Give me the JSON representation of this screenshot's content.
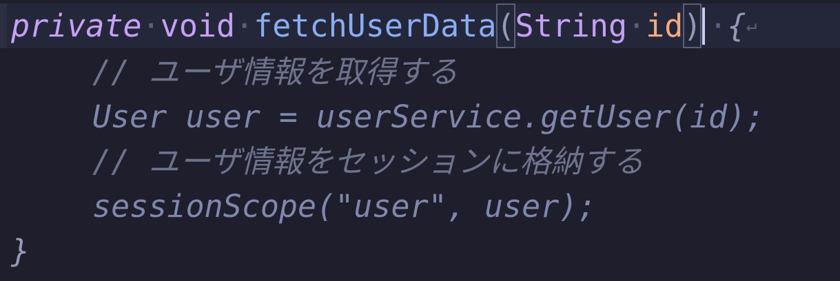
{
  "editor": {
    "line1": {
      "kw_private": "private",
      "kw_void": "void",
      "fn_name": "fetchUserData",
      "open_paren": "(",
      "param_type": "String",
      "param_name": "id",
      "close_paren": ")",
      "open_brace": "{",
      "ws_dot": "·",
      "eol_mark": "↵"
    },
    "line2": {
      "comment": "// ユーザ情報を取得する"
    },
    "line3": {
      "code": "User user = userService.getUser(id);"
    },
    "line4": {
      "comment": "// ユーザ情報をセッションに格納する"
    },
    "line5": {
      "code": "sessionScope(\"user\", user);"
    },
    "line6": {
      "close_brace": "}"
    }
  },
  "theme": {
    "background": "#1e1e2c",
    "current_line": "#24273a",
    "keyword": "#c6a0f6",
    "function": "#8aadf4",
    "parameter": "#f5a97f",
    "comment": "#6e738d"
  }
}
